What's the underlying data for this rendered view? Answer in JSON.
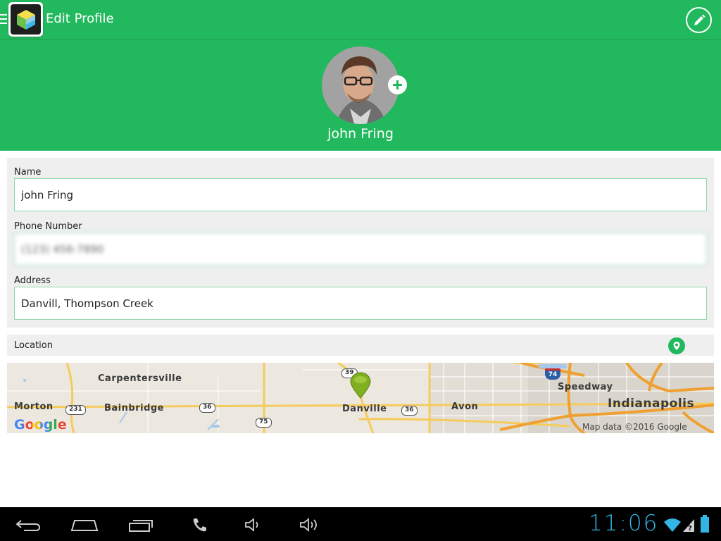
{
  "appbar": {
    "title": "Edit Profile",
    "menu_icon": "hamburger-icon",
    "logo_icon": "cube-logo-icon",
    "edit_icon": "pencil-icon"
  },
  "profile": {
    "name": "john Fring",
    "add_photo_icon": "plus-icon"
  },
  "form": {
    "name_label": "Name",
    "name_value": "john Fring",
    "phone_label": "Phone Number",
    "phone_value": "(123) 456-7890",
    "address_label": "Address",
    "address_value": "Danvill, Thompson Creek"
  },
  "location": {
    "label": "Location",
    "pin_icon": "location-pin-icon"
  },
  "map": {
    "places": {
      "carpentersville": "Carpentersville",
      "morton": "Morton",
      "bainbridge": "Bainbridge",
      "danville": "Danville",
      "avon": "Avon",
      "speedway": "Speedway",
      "indianapolis": "Indianapolis"
    },
    "routes": {
      "us231": "231",
      "us36a": "36",
      "us36b": "36",
      "r75": "75",
      "r39": "39",
      "i74": "74"
    },
    "google": "Google",
    "credit": "Map data ©2016 Google"
  },
  "system": {
    "clock": "11:06",
    "back_icon": "back-icon",
    "home_icon": "home-icon",
    "recents_icon": "recents-icon",
    "phone_icon": "phone-icon",
    "volume_down_icon": "volume-down-icon",
    "volume_up_icon": "volume-up-icon",
    "wifi_icon": "wifi-icon",
    "signal_icon": "signal-icon",
    "battery_icon": "battery-icon"
  },
  "colors": {
    "accent": "#22b95e",
    "input_border": "#8fd8a9",
    "clock": "#33b5e5"
  }
}
